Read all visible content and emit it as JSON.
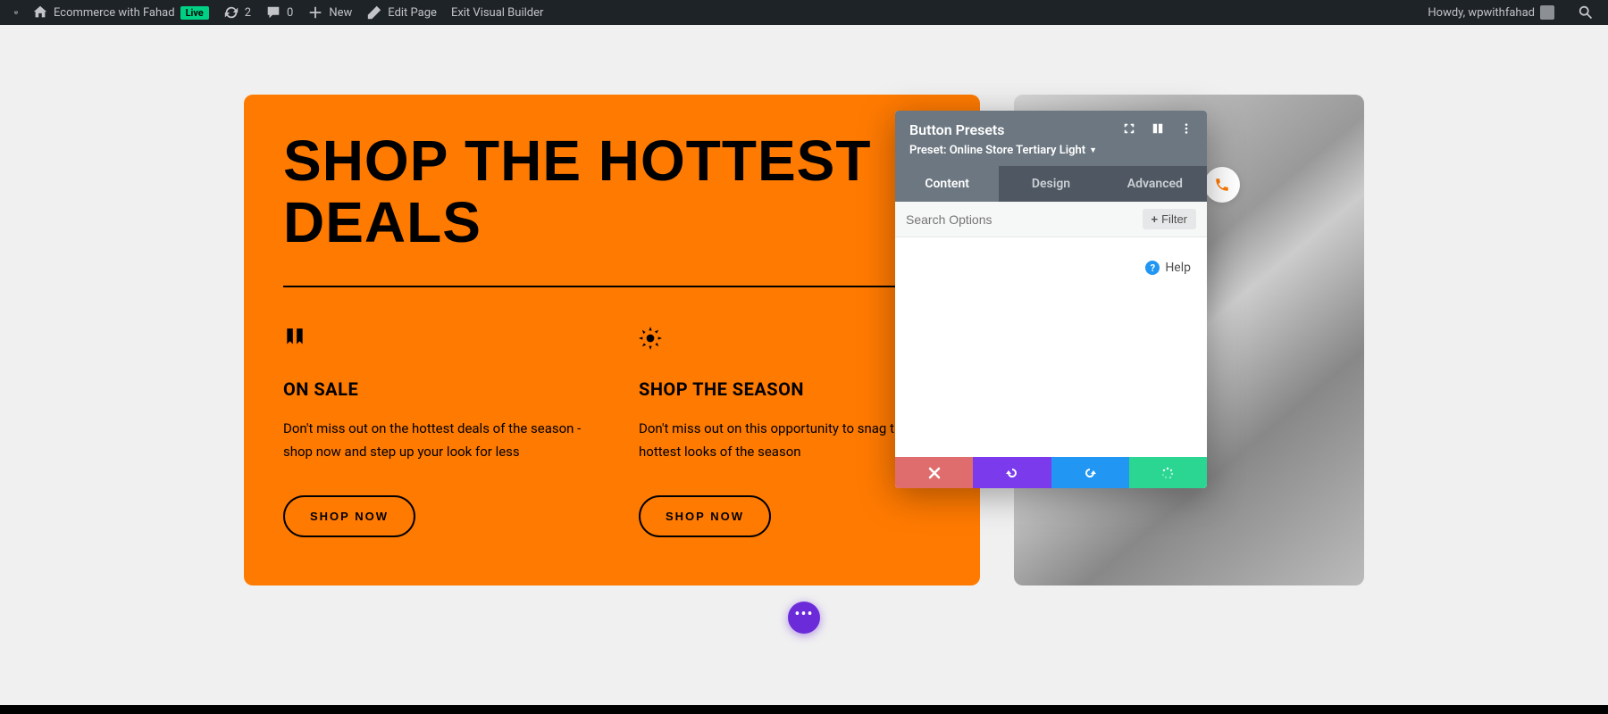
{
  "adminBar": {
    "siteName": "Ecommerce with Fahad",
    "liveBadge": "Live",
    "updatesCount": "2",
    "commentsCount": "0",
    "newLabel": "New",
    "editPageLabel": "Edit Page",
    "exitBuilderLabel": "Exit Visual Builder",
    "howdy": "Howdy, wpwithfahad"
  },
  "hero": {
    "title": "SHOP THE HOTTEST DEALS",
    "cols": [
      {
        "heading": "ON SALE",
        "text": "Don't miss out on the hottest deals of the season - shop now and step up your look for less",
        "button": "SHOP NOW"
      },
      {
        "heading": "SHOP THE SEASON",
        "text": "Don't miss out on this opportunity to snag the hottest looks of the season",
        "button": "SHOP NOW"
      }
    ]
  },
  "panel": {
    "title": "Button Presets",
    "presetLabel": "Preset: Online Store Tertiary Light",
    "tabs": [
      "Content",
      "Design",
      "Advanced"
    ],
    "activeTab": 0,
    "searchPlaceholder": "Search Options",
    "filterLabel": "Filter",
    "helpLabel": "Help"
  },
  "fab": "•••"
}
